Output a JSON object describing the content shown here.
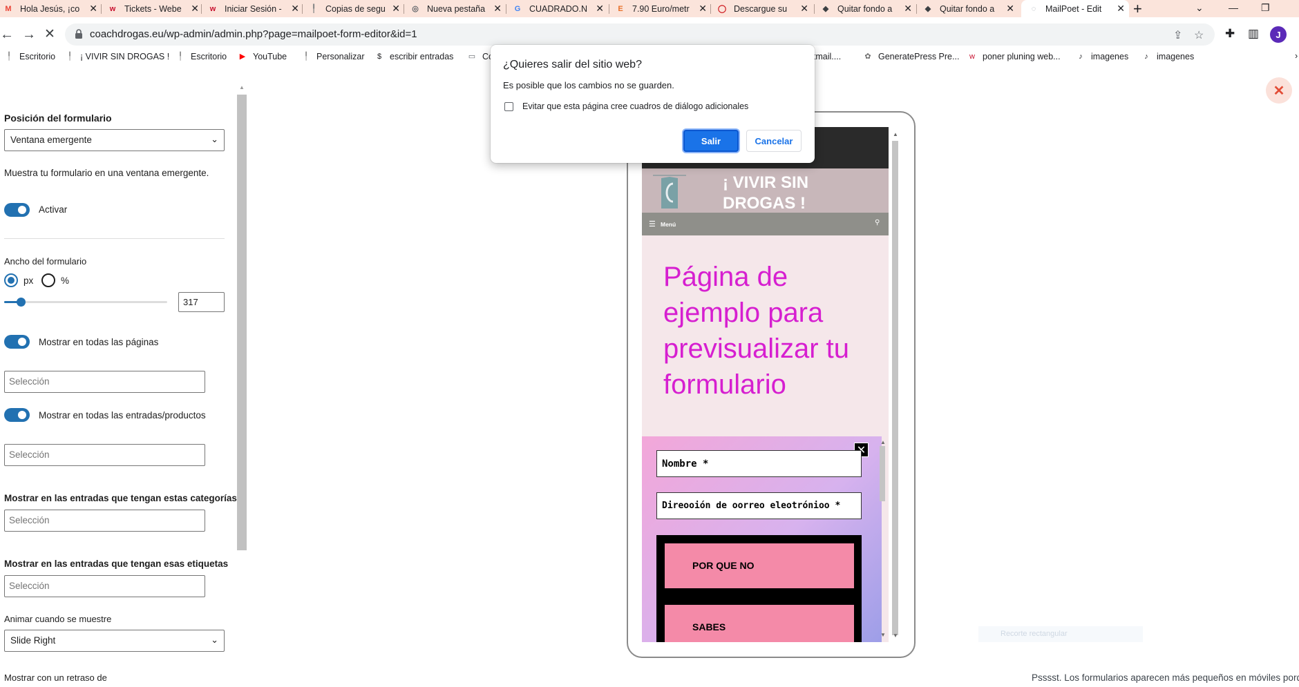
{
  "browser": {
    "tabs": [
      {
        "title": "Hola Jesús, ¡co",
        "icon": "gmail-icon",
        "color": "#ea4335",
        "glyph": "M"
      },
      {
        "title": "Tickets - Webe",
        "icon": "webempresa-icon",
        "color": "#c8102e",
        "glyph": "w"
      },
      {
        "title": "Iniciar Sesión -",
        "icon": "webempresa-circle-icon",
        "color": "#c8102e",
        "glyph": "w"
      },
      {
        "title": "Copias de segu",
        "icon": "pin-icon",
        "color": "#8a8a8a",
        "glyph": "╿"
      },
      {
        "title": "Nueva pestaña",
        "icon": "chrome-icon",
        "color": "#5f6368",
        "glyph": "◎"
      },
      {
        "title": "CUADRADO.N",
        "icon": "google-icon",
        "color": "#4285f4",
        "glyph": "G"
      },
      {
        "title": "7.90 Euro/metr",
        "icon": "e-letter-icon",
        "color": "#e8702a",
        "glyph": "E"
      },
      {
        "title": "Descargue su",
        "icon": "opera-icon",
        "color": "#cc0f16",
        "glyph": "◯"
      },
      {
        "title": "Quitar fondo a",
        "icon": "layers-icon",
        "color": "#3c4043",
        "glyph": "◆"
      },
      {
        "title": "Quitar fondo a",
        "icon": "layers-icon",
        "color": "#3c4043",
        "glyph": "◆"
      },
      {
        "title": "MailPoet - Edit",
        "icon": "loading-icon",
        "color": "#9aa0a6",
        "glyph": "◌"
      }
    ],
    "url": "coachdrogas.eu/wp-admin/admin.php?page=mailpoet-form-editor&id=1",
    "avatar_letter": "J",
    "bookmarks": [
      {
        "label": "Escritorio",
        "glyph": "╿",
        "color": "#8a8a8a"
      },
      {
        "label": "¡ VIVIR SIN DROGAS !",
        "glyph": "╿",
        "color": "#8a8a8a"
      },
      {
        "label": "Escritorio",
        "glyph": "╿",
        "color": "#8a8a8a"
      },
      {
        "label": "YouTube",
        "glyph": "▶",
        "color": "#ff0000"
      },
      {
        "label": "Personalizar",
        "glyph": "╿",
        "color": "#8a8a8a"
      },
      {
        "label": "escribir entradas",
        "glyph": "$",
        "color": "#202124"
      },
      {
        "label": "Co",
        "glyph": "▭",
        "color": "#5f6368"
      },
      {
        "label": "hotmail....",
        "glyph": "",
        "color": "#202124"
      },
      {
        "label": "GeneratePress Pre...",
        "glyph": "✿",
        "color": "#6b6b6b"
      },
      {
        "label": "poner pluning web...",
        "glyph": "w",
        "color": "#c8102e"
      },
      {
        "label": "imagenes",
        "glyph": "♪",
        "color": "#202124"
      },
      {
        "label": "imagenes",
        "glyph": "♪",
        "color": "#202124"
      }
    ]
  },
  "panel": {
    "position_heading": "Posición del formulario",
    "position_value": "Ventana emergente",
    "position_desc": "Muestra tu formulario en una ventana emergente.",
    "activate_label": "Activar",
    "width_label": "Ancho del formulario",
    "unit_px": "px",
    "unit_percent": "%",
    "width_value": "317",
    "width_slider_fraction": 0.1,
    "show_all_pages": "Mostrar en todas las páginas",
    "pages_placeholder": "Selección",
    "show_all_posts": "Mostrar en todas las entradas/productos",
    "posts_placeholder": "Selección",
    "categories_heading": "Mostrar en las entradas que tengan estas categorías",
    "categories_placeholder": "Selección",
    "tags_heading": "Mostrar en las entradas que tengan esas etiquetas",
    "tags_placeholder": "Selección",
    "animate_label": "Animar cuando se muestre",
    "animate_value": "Slide Right",
    "delay_label": "Mostrar con un retraso de"
  },
  "preview": {
    "site_title": "¡ VIVIR SIN DROGAS !",
    "menu_label": "Menú",
    "heading": "Página de ejemplo para previsualizar tu formulario",
    "name_field": "Nombre *",
    "email_field": "Direooión de oorreo eleotrónioo *",
    "button_1": "POR QUE NO",
    "button_2": "SABES",
    "ghost_text": "Recorte rectangular",
    "footnote": "Psssst. Los formularios aparecen más pequeños en móviles porque"
  },
  "dialog": {
    "title": "¿Quieres salir del sitio web?",
    "message": "Es posible que los cambios no se guarden.",
    "checkbox_label": "Evitar que esta página cree cuadros de diálogo adicionales",
    "leave_label": "Salir",
    "cancel_label": "Cancelar"
  }
}
